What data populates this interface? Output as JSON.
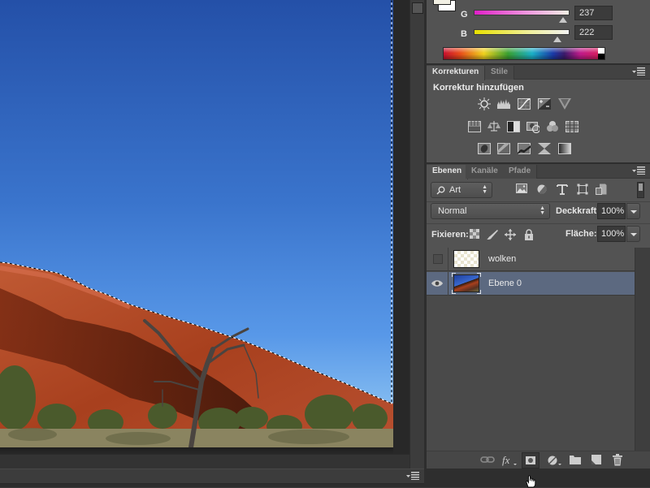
{
  "canvas": {
    "image_description": "Uluru red rock against blue sky with dead tree and bushes",
    "selection": "marching-ants selection around sky"
  },
  "color_panel": {
    "channels": [
      {
        "label": "G",
        "value": "237",
        "fraction": 0.929
      },
      {
        "label": "B",
        "value": "222",
        "fraction": 0.871
      }
    ],
    "foreground_color": "#f2f0e4",
    "background_color": "#ffffff"
  },
  "adjustments_panel": {
    "tabs": [
      {
        "label": "Korrekturen",
        "active": true
      },
      {
        "label": "Stile",
        "active": false
      }
    ],
    "heading": "Korrektur hinzufügen",
    "icons_row1": [
      "brightness-contrast-icon",
      "levels-icon",
      "curves-icon",
      "exposure-icon",
      "vibrance-icon"
    ],
    "icons_row2": [
      "hue-saturation-icon",
      "color-balance-icon",
      "black-white-icon",
      "photo-filter-icon",
      "channel-mixer-icon",
      "color-lookup-icon"
    ],
    "icons_row3": [
      "invert-icon",
      "posterize-icon",
      "threshold-icon",
      "selective-color-icon",
      "gradient-map-icon"
    ]
  },
  "layers_panel": {
    "tabs": [
      {
        "label": "Ebenen",
        "active": true
      },
      {
        "label": "Kanäle",
        "active": false
      },
      {
        "label": "Pfade",
        "active": false
      }
    ],
    "filter_type": "Art",
    "blend_mode": "Normal",
    "opacity_label": "Deckkraft:",
    "opacity_value": "100%",
    "lock_label": "Fixieren:",
    "fill_label": "Fläche:",
    "fill_value": "100%",
    "layers": [
      {
        "name": "wolken",
        "visible": false,
        "selected": false,
        "thumbnail": "transparent"
      },
      {
        "name": "Ebene 0",
        "visible": true,
        "selected": true,
        "thumbnail": "photo"
      }
    ],
    "footer_icons": [
      "link-layers-icon",
      "fx-icon",
      "add-mask-icon",
      "adjustment-layer-icon",
      "new-group-icon",
      "new-layer-icon",
      "delete-layer-icon"
    ]
  },
  "colors": {
    "panel_bg": "#535353",
    "selected_layer": "#5c6980",
    "canvas_bg": "#282828"
  }
}
